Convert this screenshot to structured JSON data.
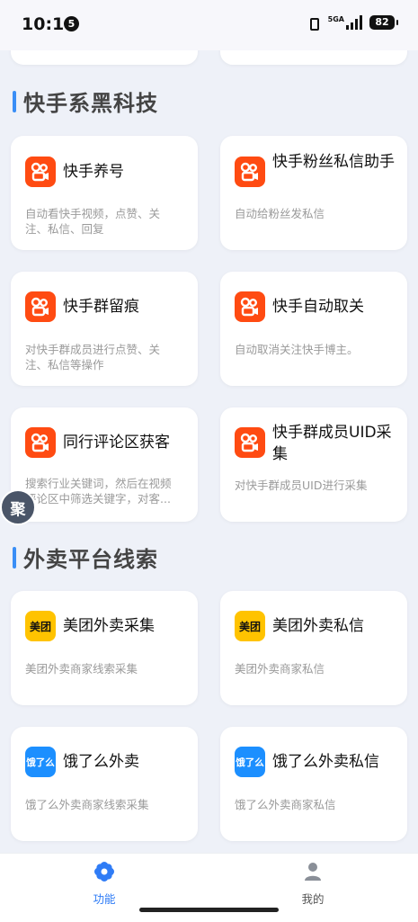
{
  "status_bar": {
    "time": "10:16",
    "notification_count": "5",
    "network": "5GA",
    "battery": "82"
  },
  "sections": [
    {
      "title": "快手系黑科技",
      "cards": [
        {
          "title": "快手养号",
          "desc": "自动看快手视频，点赞、关注、私信、回复",
          "icon": "kuaishou-logo"
        },
        {
          "title": "快手粉丝私信助手",
          "desc": "自动给粉丝发私信",
          "icon": "kuaishou-logo"
        },
        {
          "title": "快手群留痕",
          "desc": "对快手群成员进行点赞、关注、私信等操作",
          "icon": "kuaishou-logo"
        },
        {
          "title": "快手自动取关",
          "desc": "自动取消关注快手博主。",
          "icon": "kuaishou-logo"
        },
        {
          "title": "同行评论区获客",
          "desc": "搜索行业关键词，然后在视频评论区中筛选关键字，对客...",
          "icon": "kuaishou-logo"
        },
        {
          "title": "快手群成员UID采集",
          "desc": "对快手群成员UID进行采集",
          "icon": "kuaishou-logo"
        }
      ]
    },
    {
      "title": "外卖平台线索",
      "cards": [
        {
          "title": "美团外卖采集",
          "desc": "美团外卖商家线索采集",
          "icon": "meituan-logo",
          "logo_text": "美团"
        },
        {
          "title": "美团外卖私信",
          "desc": "美团外卖商家私信",
          "icon": "meituan-logo",
          "logo_text": "美团"
        },
        {
          "title": "饿了么外卖",
          "desc": "饿了么外卖商家线索采集",
          "icon": "eleme-logo",
          "logo_text": "饿了么"
        },
        {
          "title": "饿了么外卖私信",
          "desc": "饿了么外卖商家私信",
          "icon": "eleme-logo",
          "logo_text": "饿了么"
        }
      ]
    }
  ],
  "floating_button": {
    "label": "聚"
  },
  "tab_bar": {
    "items": [
      {
        "label": "功能",
        "icon": "flower-icon",
        "active": true
      },
      {
        "label": "我的",
        "icon": "person-icon",
        "active": false
      }
    ]
  },
  "colors": {
    "accent": "#3a8ef6",
    "kuaishou": "#ff4b12",
    "meituan": "#ffc300",
    "eleme": "#1c8fff"
  }
}
